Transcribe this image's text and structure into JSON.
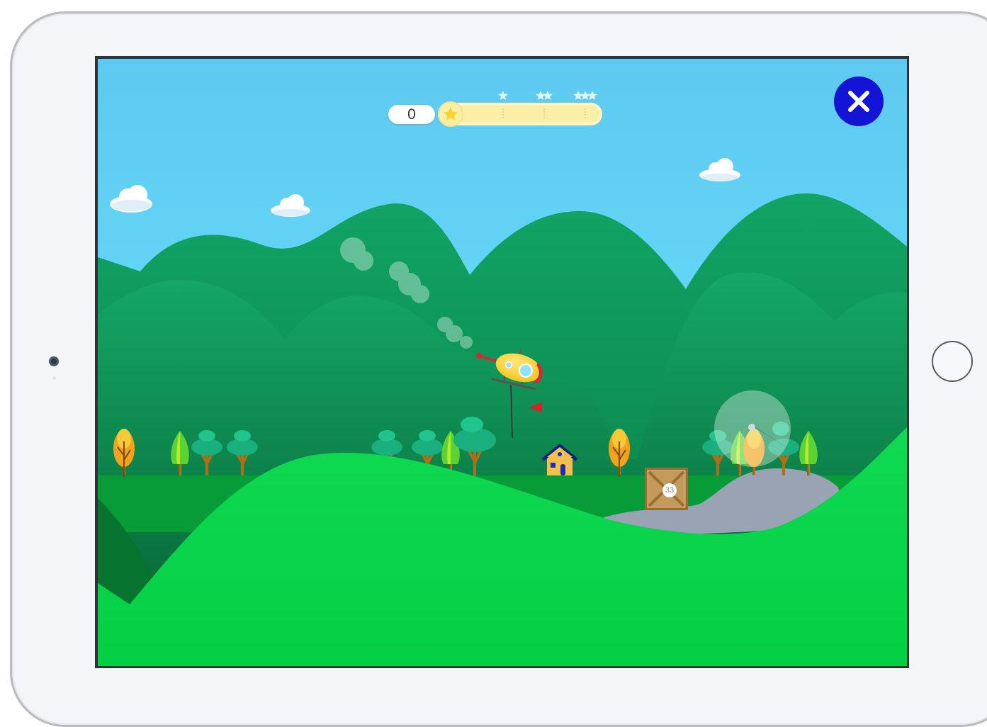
{
  "game": {
    "score": "0",
    "progress_fraction": 0.0,
    "star_thresholds": 3,
    "crate_number": "33"
  },
  "colors": {
    "sky_top": "#5ec9f0",
    "sky_bottom": "#66e3ff",
    "close_button": "#1414d6",
    "progress_track": "#fbeea6",
    "star": "#f8d321",
    "grass": "#0ad34a",
    "mountain": "#0d9b5a",
    "road": "#9aa3b3"
  },
  "icons": {
    "close": "close-icon",
    "star": "star-icon",
    "helicopter": "helicopter-icon",
    "crate": "crate-icon",
    "house": "house-icon",
    "flag": "flag-icon",
    "direction_indicator": "direction-indicator-icon"
  }
}
